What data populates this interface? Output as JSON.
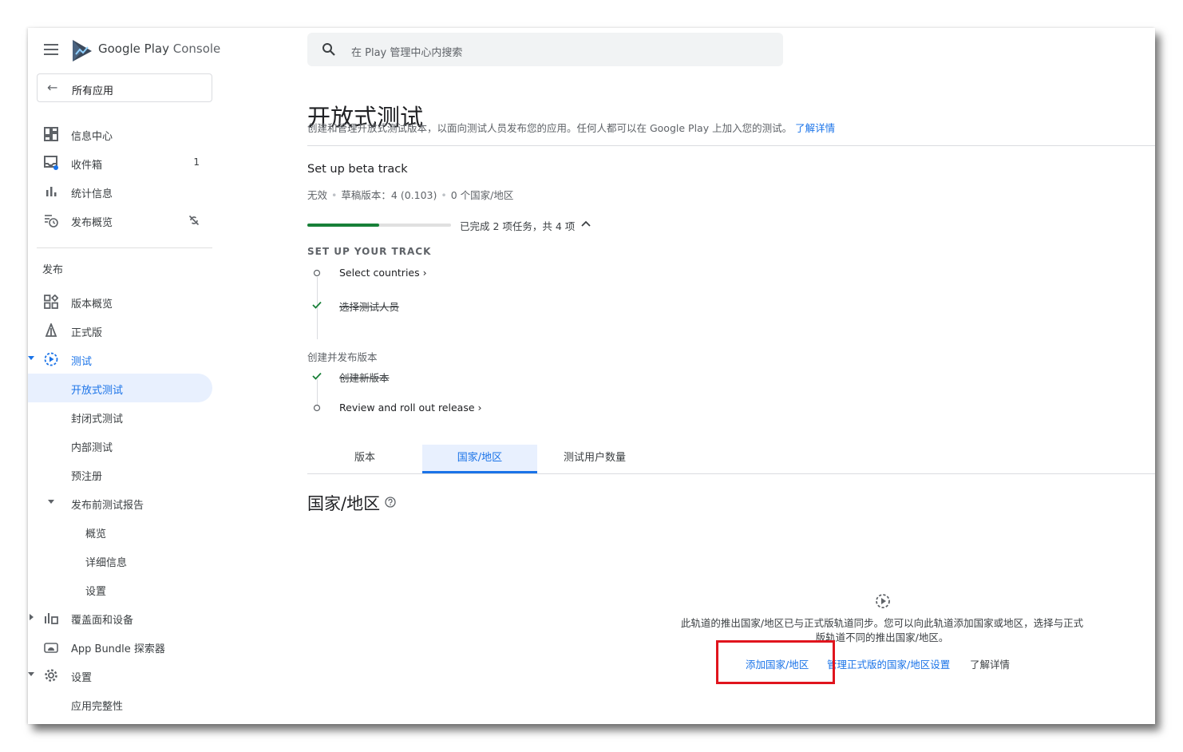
{
  "app": {
    "name_main": "Google Play",
    "name_suffix": "Console"
  },
  "sidebar": {
    "all_apps_label": "所有应用",
    "items_top": [
      {
        "label": "信息中心",
        "icon": "dashboard-icon"
      },
      {
        "label": "收件箱",
        "icon": "inbox-icon",
        "badge": "1"
      },
      {
        "label": "统计信息",
        "icon": "bar-chart-icon"
      },
      {
        "label": "发布概览",
        "icon": "publishing-overview-icon"
      }
    ],
    "section_title": "发布",
    "items_release": [
      {
        "label": "版本概览"
      },
      {
        "label": "正式版"
      },
      {
        "label": "测试"
      },
      {
        "label": "开放式测试"
      },
      {
        "label": "封闭式测试"
      },
      {
        "label": "内部测试"
      },
      {
        "label": "预注册"
      },
      {
        "label": "发布前测试报告"
      },
      {
        "label": "概览"
      },
      {
        "label": "详细信息"
      },
      {
        "label": "设置"
      },
      {
        "label": "覆盖面和设备"
      },
      {
        "label": "App Bundle 探索器"
      },
      {
        "label": "设置"
      },
      {
        "label": "应用完整性"
      }
    ]
  },
  "search": {
    "placeholder": "在 Play 管理中心内搜索"
  },
  "page": {
    "title": "开放式测试",
    "description": "创建和管理开放式测试版本，以面向测试人员发布您的应用。任何人都可以在 Google Play 上加入您的测试。",
    "learn_more": "了解详情"
  },
  "track": {
    "title": "Set up beta track",
    "status": "无效",
    "draft": "草稿版本：4 (0.103)",
    "countries": "0 个国家/地区",
    "progress_text": "已完成 2 项任务，共 4 项",
    "progress_fraction": 0.5,
    "group1_title": "SET UP YOUR TRACK",
    "group1_steps": [
      {
        "label": "Select countries ›",
        "done": false
      },
      {
        "label": "选择测试人员",
        "done": true
      }
    ],
    "group2_title": "创建并发布版本",
    "group2_steps": [
      {
        "label": "创建新版本",
        "done": true
      },
      {
        "label": "Review and roll out release ›",
        "done": false
      }
    ]
  },
  "tabs": [
    {
      "label": "版本",
      "active": false
    },
    {
      "label": "国家/地区",
      "active": true
    },
    {
      "label": "测试用户数量",
      "active": false
    }
  ],
  "countries_section": {
    "heading": "国家/地区",
    "empty_text": "此轨道的推出国家/地区已与正式版轨道同步。您可以向此轨道添加国家或地区，选择与正式版轨道不同的推出国家/地区。",
    "add_link": "添加国家/地区",
    "manage_link": "管理正式版的国家/地区设置",
    "learn_more": "了解详情"
  },
  "colors": {
    "accent": "#1a73e8",
    "success": "#188038",
    "highlight": "#e0141d"
  }
}
